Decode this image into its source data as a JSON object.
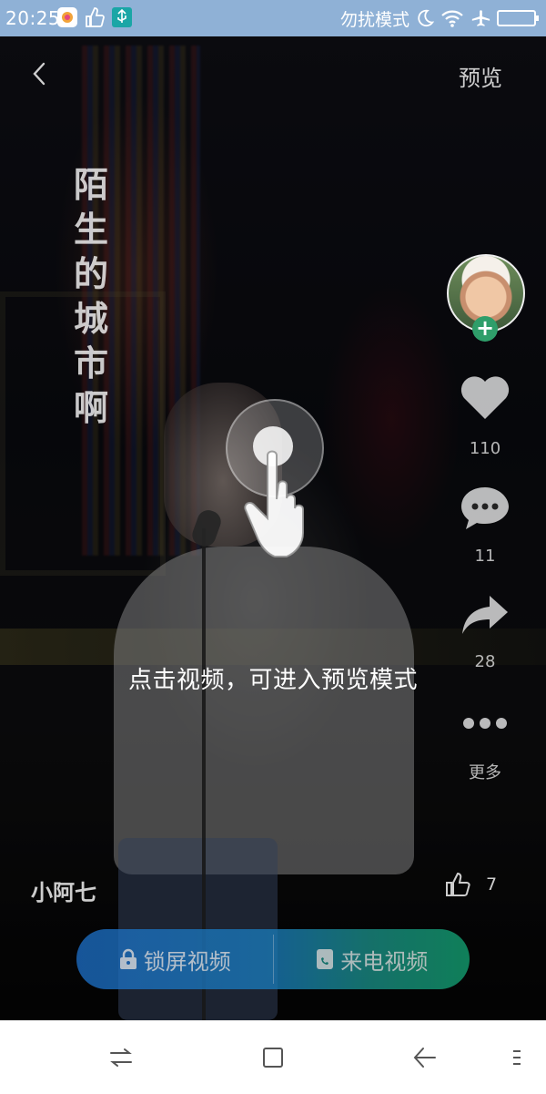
{
  "status_bar": {
    "time": "20:25",
    "dnd_label": "勿扰模式"
  },
  "header": {
    "preview_label": "预览"
  },
  "video": {
    "vertical_title": "陌生的城市啊"
  },
  "side_rail": {
    "likes": "110",
    "comments": "11",
    "shares": "28",
    "more_label": "更多"
  },
  "overlay": {
    "hint_text": "点击视频，可进入预览模式"
  },
  "footer": {
    "username": "小阿七",
    "like_count": "7"
  },
  "actions": {
    "lock_screen_label": "锁屏视频",
    "ringtone_label": "来电视频"
  },
  "colors": {
    "status_bar_bg": "#8fb1d6",
    "action_left": "#1c6cc3",
    "action_right": "#13a271",
    "follow_plus": "#2f9e6a"
  },
  "icons": [
    "back-icon",
    "heart-icon",
    "comment-icon",
    "share-icon",
    "more-dots-icon",
    "thumbs-up-icon",
    "lock-icon",
    "phone-video-icon",
    "nav-switch-icon",
    "nav-home-icon",
    "nav-back-icon",
    "nav-menu-icon",
    "wifi-icon",
    "airplane-icon",
    "battery-icon",
    "moon-icon"
  ]
}
